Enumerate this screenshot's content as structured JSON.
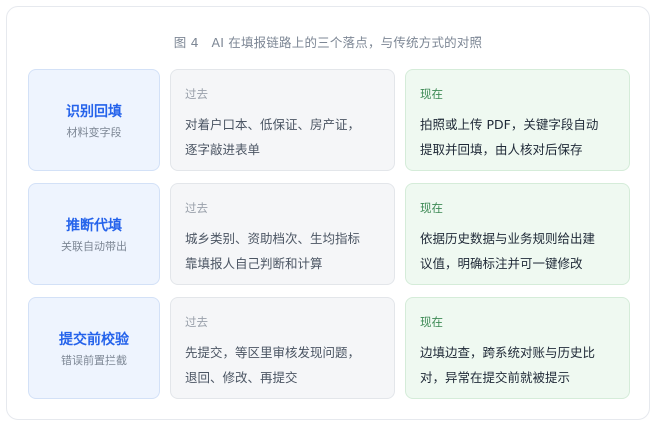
{
  "caption": "图 4　AI 在填报链路上的三个落点，与传统方式的对照",
  "rows": [
    {
      "title": "识别回填",
      "subtitle": "材料变字段",
      "past_tag": "过去",
      "past_lines": [
        "对着户口本、低保证、房产证，",
        "逐字敲进表单"
      ],
      "now_tag": "现在",
      "now_lines": [
        "拍照或上传 PDF，关键字段自动",
        "提取并回填，由人核对后保存"
      ]
    },
    {
      "title": "推断代填",
      "subtitle": "关联自动带出",
      "past_tag": "过去",
      "past_lines": [
        "城乡类别、资助档次、生均指标",
        "靠填报人自己判断和计算"
      ],
      "now_tag": "现在",
      "now_lines": [
        "依据历史数据与业务规则给出建",
        "议值，明确标注并可一键修改"
      ]
    },
    {
      "title": "提交前校验",
      "subtitle": "错误前置拦截",
      "past_tag": "过去",
      "past_lines": [
        "先提交，等区里审核发现问题，",
        "退回、修改、再提交"
      ],
      "now_tag": "现在",
      "now_lines": [
        "边填边查，跨系统对账与历史比",
        "对，异常在提交前就被提示"
      ]
    }
  ]
}
